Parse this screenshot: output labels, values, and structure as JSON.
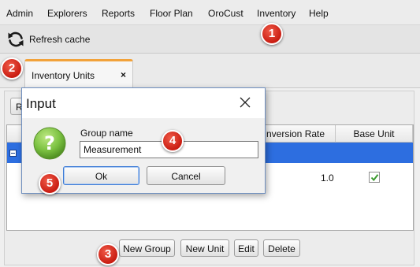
{
  "menu": [
    "Admin",
    "Explorers",
    "Reports",
    "Floor Plan",
    "OroCust",
    "Inventory",
    "Help"
  ],
  "toolbar": {
    "refresh_label": "Refresh cache",
    "refresh_icon": "refresh-icon"
  },
  "tab": {
    "label": "Inventory Units",
    "close": "×"
  },
  "content": {
    "partial_button_label": "R"
  },
  "table": {
    "headers": [
      "nversion Rate",
      "Base Unit"
    ],
    "rows": [
      {
        "rate": "1.0",
        "base_unit_checked": true
      }
    ]
  },
  "buttons": [
    "New Group",
    "New Unit",
    "Edit",
    "Delete"
  ],
  "dialog": {
    "title": "Input",
    "field_label": "Group name",
    "field_value": "Measurement",
    "ok_label": "Ok",
    "cancel_label": "Cancel",
    "icon": "help-question-icon"
  },
  "callouts": [
    "1",
    "2",
    "3",
    "4",
    "5"
  ],
  "colors": {
    "selection_row": "#2d6ee0",
    "tab_accent": "#f2a23a",
    "callout": "#d9281a",
    "help_icon": "#7cc242",
    "checkmark": "#3a9a2e"
  }
}
